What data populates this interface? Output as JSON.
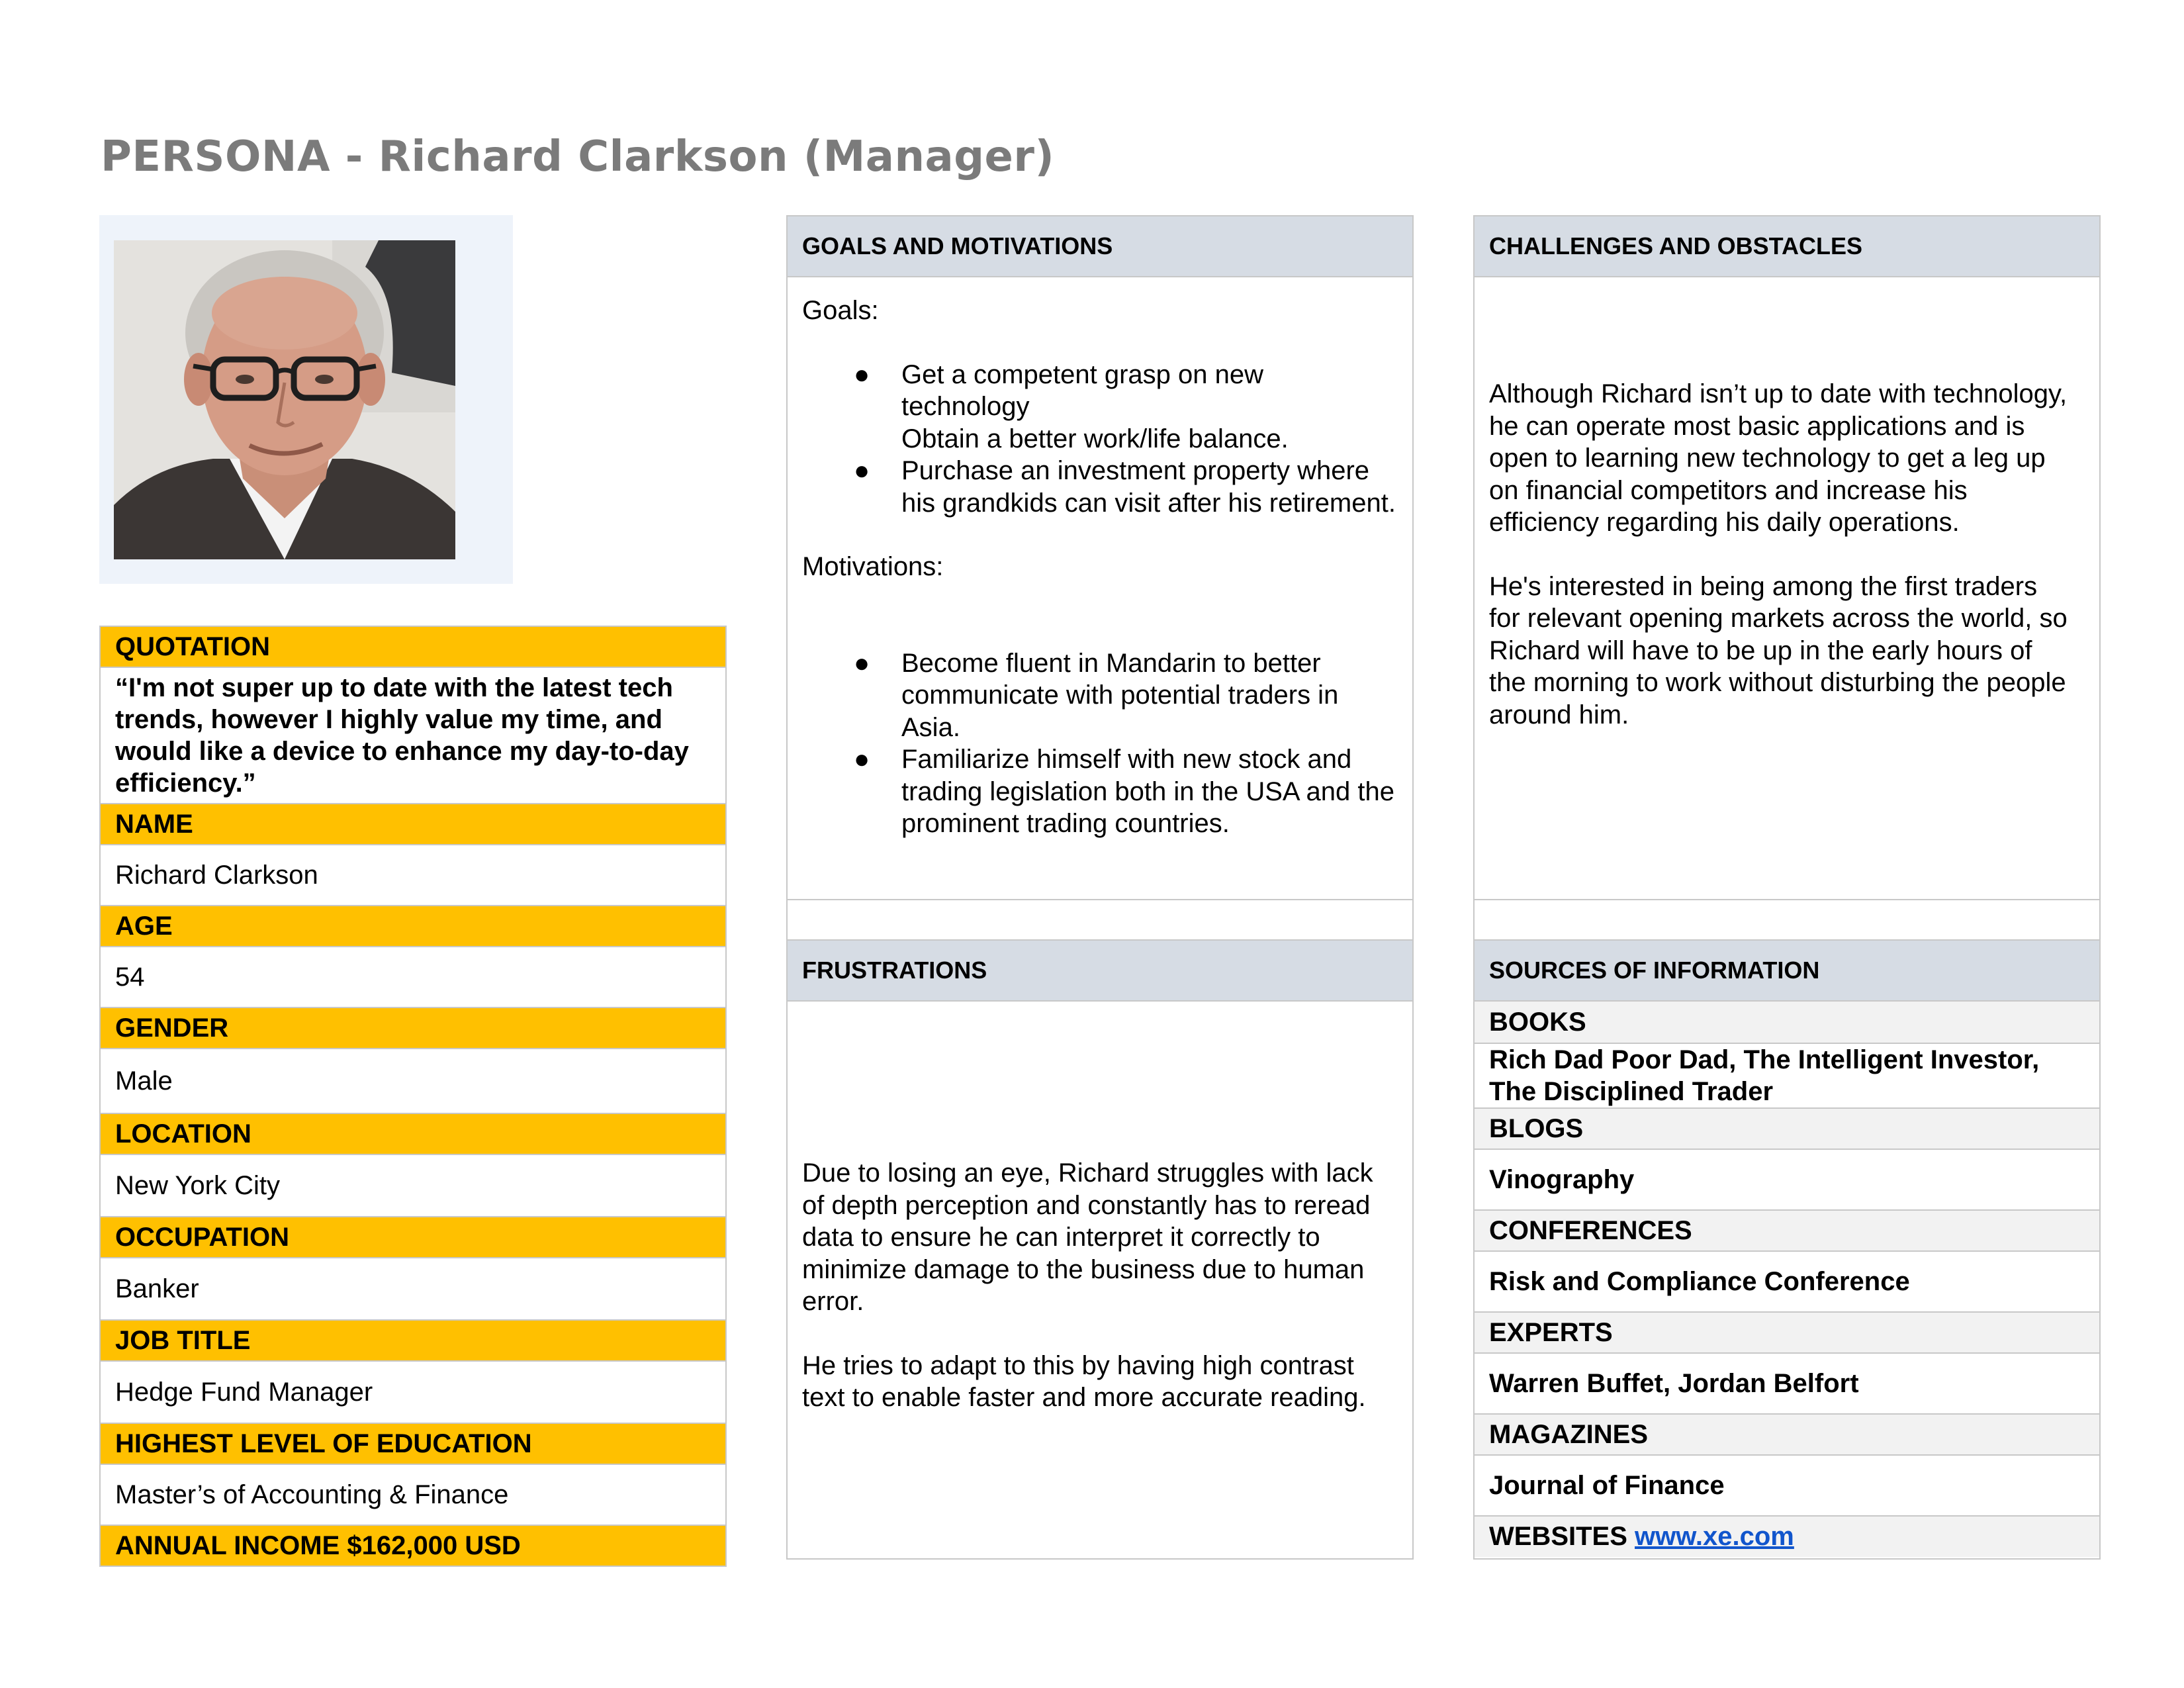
{
  "title": "PERSONA - Richard Clarkson (Manager)",
  "info": {
    "quotation_label": "QUOTATION",
    "quotation": "“I'm not super up to date with the latest tech trends, however I highly value my time, and would like a device to enhance my day-to-day efficiency.”",
    "name_label": "NAME",
    "name": "Richard Clarkson",
    "age_label": "AGE",
    "age": "54",
    "gender_label": "GENDER",
    "gender": "Male",
    "location_label": "LOCATION",
    "location": "New York City",
    "occupation_label": "OCCUPATION",
    "occupation": "Banker",
    "job_title_label": "JOB TITLE",
    "job_title": "Hedge Fund Manager",
    "education_label": "HIGHEST LEVEL OF EDUCATION",
    "education": "Master’s of Accounting & Finance",
    "income": "ANNUAL INCOME $162,000 USD"
  },
  "goals": {
    "header": "GOALS AND MOTIVATIONS",
    "goals_label": "Goals:",
    "goal_1": "Get a competent grasp on new technology",
    "goal_1b": "Obtain a better work/life balance.",
    "goal_2": "Purchase an investment property where his grandkids can visit after his retirement.",
    "motivations_label": "Motivations:",
    "motivation_1": "Become fluent in Mandarin to better communicate with potential traders in Asia.",
    "motivation_2": "Familiarize himself with new stock and trading legislation both in the USA and the prominent trading countries.",
    "bullet": "●"
  },
  "challenges": {
    "header": "CHALLENGES AND OBSTACLES",
    "p1": "Although Richard isn’t up to date with technology, he can operate most basic applications and is open to learning new technology to get a leg up on financial competitors and increase his efficiency regarding his daily operations.",
    "p2": "He's interested in being among the first traders for relevant opening markets across the world, so Richard will have to be up in the early hours of the morning to work without disturbing the people around him."
  },
  "frustrations": {
    "header": "FRUSTRATIONS",
    "p1": "Due to losing an eye, Richard struggles with lack of depth perception and constantly has to reread data to ensure he can interpret it correctly to minimize damage to the business due to human error.",
    "p2": "He tries to adapt to this by having high contrast text to enable faster and more accurate reading."
  },
  "sources": {
    "header": "SOURCES OF INFORMATION",
    "books_label": "BOOKS",
    "books": "Rich Dad Poor Dad, The Intelligent Investor, The Disciplined Trader",
    "blogs_label": "BLOGS",
    "blogs": "Vinography",
    "conferences_label": "CONFERENCES",
    "conferences": "Risk and Compliance Conference",
    "experts_label": "EXPERTS",
    "experts": "Warren Buffet, Jordan Belfort",
    "magazines_label": "MAGAZINES",
    "magazines": "Journal of Finance",
    "websites_label": "WEBSITES",
    "websites_link": "www.xe.com"
  },
  "colors": {
    "label_fill": "#ffc000",
    "panel_header_fill": "#d6dce4",
    "title_gray": "#7b7b7b",
    "link_blue": "#1155cc"
  }
}
